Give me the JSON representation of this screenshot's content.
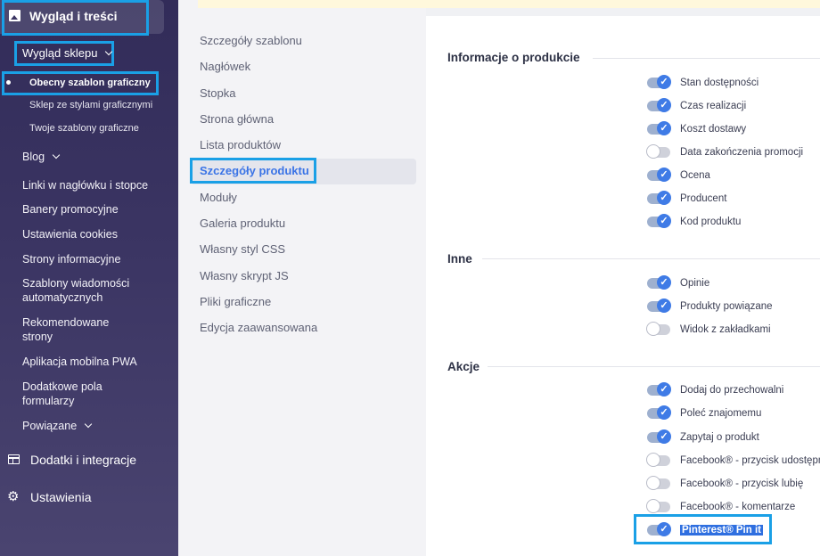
{
  "sidebar": {
    "section_title": "Wygląd i treści",
    "sub_section": "Wygląd sklepu",
    "sub_items": [
      "Obecny szablon graficzny",
      "Sklep ze stylami graficznymi",
      "Twoje szablony graficzne"
    ],
    "items": [
      {
        "label": "Blog",
        "expandable": true
      },
      {
        "label": "Linki w nagłówku i stopce"
      },
      {
        "label": "Banery promocyjne"
      },
      {
        "label": "Ustawienia cookies"
      },
      {
        "label": "Strony informacyjne"
      },
      {
        "label": "Szablony wiadomości automatycznych"
      },
      {
        "label": "Rekomendowane strony"
      },
      {
        "label": "Aplikacja mobilna PWA"
      },
      {
        "label": "Dodatkowe pola formularzy"
      },
      {
        "label": "Powiązane",
        "expandable": true
      }
    ],
    "bottom": [
      "Dodatki i integracje",
      "Ustawienia"
    ]
  },
  "nav": {
    "items": [
      "Szczegóły szablonu",
      "Nagłówek",
      "Stopka",
      "Strona główna",
      "Lista produktów",
      "Szczegóły produktu",
      "Moduły",
      "Galeria produktu",
      "Własny styl CSS",
      "Własny skrypt JS",
      "Pliki graficzne",
      "Edycja zaawansowana"
    ],
    "active": "Szczegóły produktu"
  },
  "sections": [
    {
      "title": "Informacje o produkcie",
      "options": [
        {
          "label": "Stan dostępności",
          "on": true
        },
        {
          "label": "Czas realizacji",
          "on": true
        },
        {
          "label": "Koszt dostawy",
          "on": true
        },
        {
          "label": "Data zakończenia promocji",
          "on": false
        },
        {
          "label": "Ocena",
          "on": true
        },
        {
          "label": "Producent",
          "on": true
        },
        {
          "label": "Kod produktu",
          "on": true
        }
      ]
    },
    {
      "title": "Inne",
      "options": [
        {
          "label": "Opinie",
          "on": true
        },
        {
          "label": "Produkty powiązane",
          "on": true
        },
        {
          "label": "Widok z zakładkami",
          "on": false
        }
      ]
    },
    {
      "title": "Akcje",
      "options": [
        {
          "label": "Dodaj do przechowalni",
          "on": true
        },
        {
          "label": "Poleć znajomemu",
          "on": true
        },
        {
          "label": "Zapytaj o produkt",
          "on": true
        },
        {
          "label": "Facebook® - przycisk udostępnij",
          "on": false
        },
        {
          "label": "Facebook® - przycisk lubię",
          "on": false
        },
        {
          "label": "Facebook® - komentarze",
          "on": false
        },
        {
          "label": "Pinterest® Pin it",
          "on": true,
          "selected": true
        }
      ]
    }
  ],
  "colors": {
    "accent": "#3f7be6",
    "highlight": "#1aa0e6",
    "sidebar": "#3b3563"
  }
}
